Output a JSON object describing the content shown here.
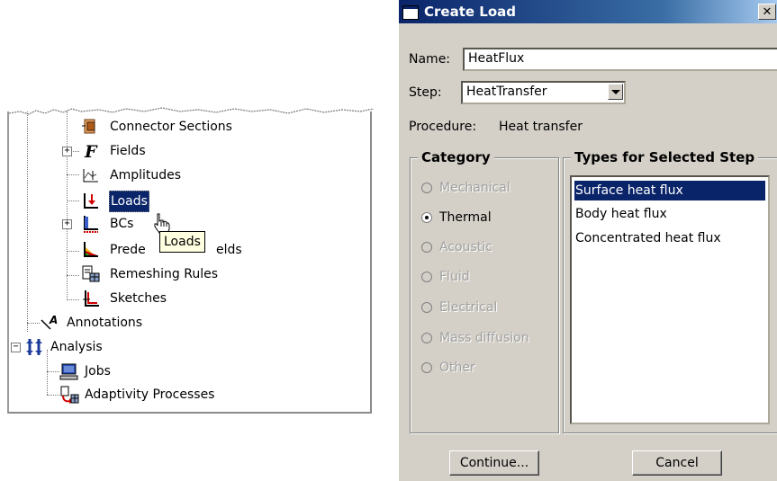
{
  "tree": {
    "items": [
      {
        "label": "Connector Sections",
        "icon": "connector-sections-icon"
      },
      {
        "label": "Fields",
        "icon": "fields-icon",
        "expand": "+"
      },
      {
        "label": "Amplitudes",
        "icon": "amplitudes-icon"
      },
      {
        "label": "Loads",
        "icon": "loads-icon"
      },
      {
        "label": "BCs",
        "icon": "bcs-icon",
        "expand": "+"
      },
      {
        "label": "Prede",
        "label_tail": "elds",
        "icon": "predefined-fields-icon"
      },
      {
        "label": "Remeshing Rules",
        "icon": "remeshing-rules-icon"
      },
      {
        "label": "Sketches",
        "icon": "sketches-icon"
      },
      {
        "label": "Annotations",
        "icon": "annotations-icon"
      },
      {
        "label": "Analysis",
        "icon": "analysis-icon",
        "expand": "−"
      },
      {
        "label": "Jobs",
        "icon": "jobs-icon"
      },
      {
        "label": "Adaptivity Processes",
        "icon": "adaptivity-processes-icon"
      }
    ],
    "tooltip": "Loads"
  },
  "dialog": {
    "title": "Create Load",
    "close_glyph": "✕",
    "name_label": "Name:",
    "name_value": "HeatFlux",
    "step_label": "Step:",
    "step_value": "HeatTransfer",
    "procedure_label": "Procedure:",
    "procedure_value": "Heat transfer",
    "category_title": "Category",
    "categories": [
      {
        "label": "Mechanical",
        "enabled": false,
        "selected": false
      },
      {
        "label": "Thermal",
        "enabled": true,
        "selected": true
      },
      {
        "label": "Acoustic",
        "enabled": false,
        "selected": false
      },
      {
        "label": "Fluid",
        "enabled": false,
        "selected": false
      },
      {
        "label": "Electrical",
        "enabled": false,
        "selected": false
      },
      {
        "label": "Mass diffusion",
        "enabled": false,
        "selected": false
      },
      {
        "label": "Other",
        "enabled": false,
        "selected": false
      }
    ],
    "types_title": "Types for Selected Step",
    "types": [
      {
        "label": "Surface heat flux",
        "selected": true
      },
      {
        "label": "Body heat flux",
        "selected": false
      },
      {
        "label": "Concentrated heat flux",
        "selected": false
      }
    ],
    "continue_label": "Continue...",
    "cancel_label": "Cancel"
  },
  "colors": {
    "selection": "#0a246a",
    "dialog_face": "#d4d0c8",
    "tooltip_bg": "#ffffe1"
  }
}
